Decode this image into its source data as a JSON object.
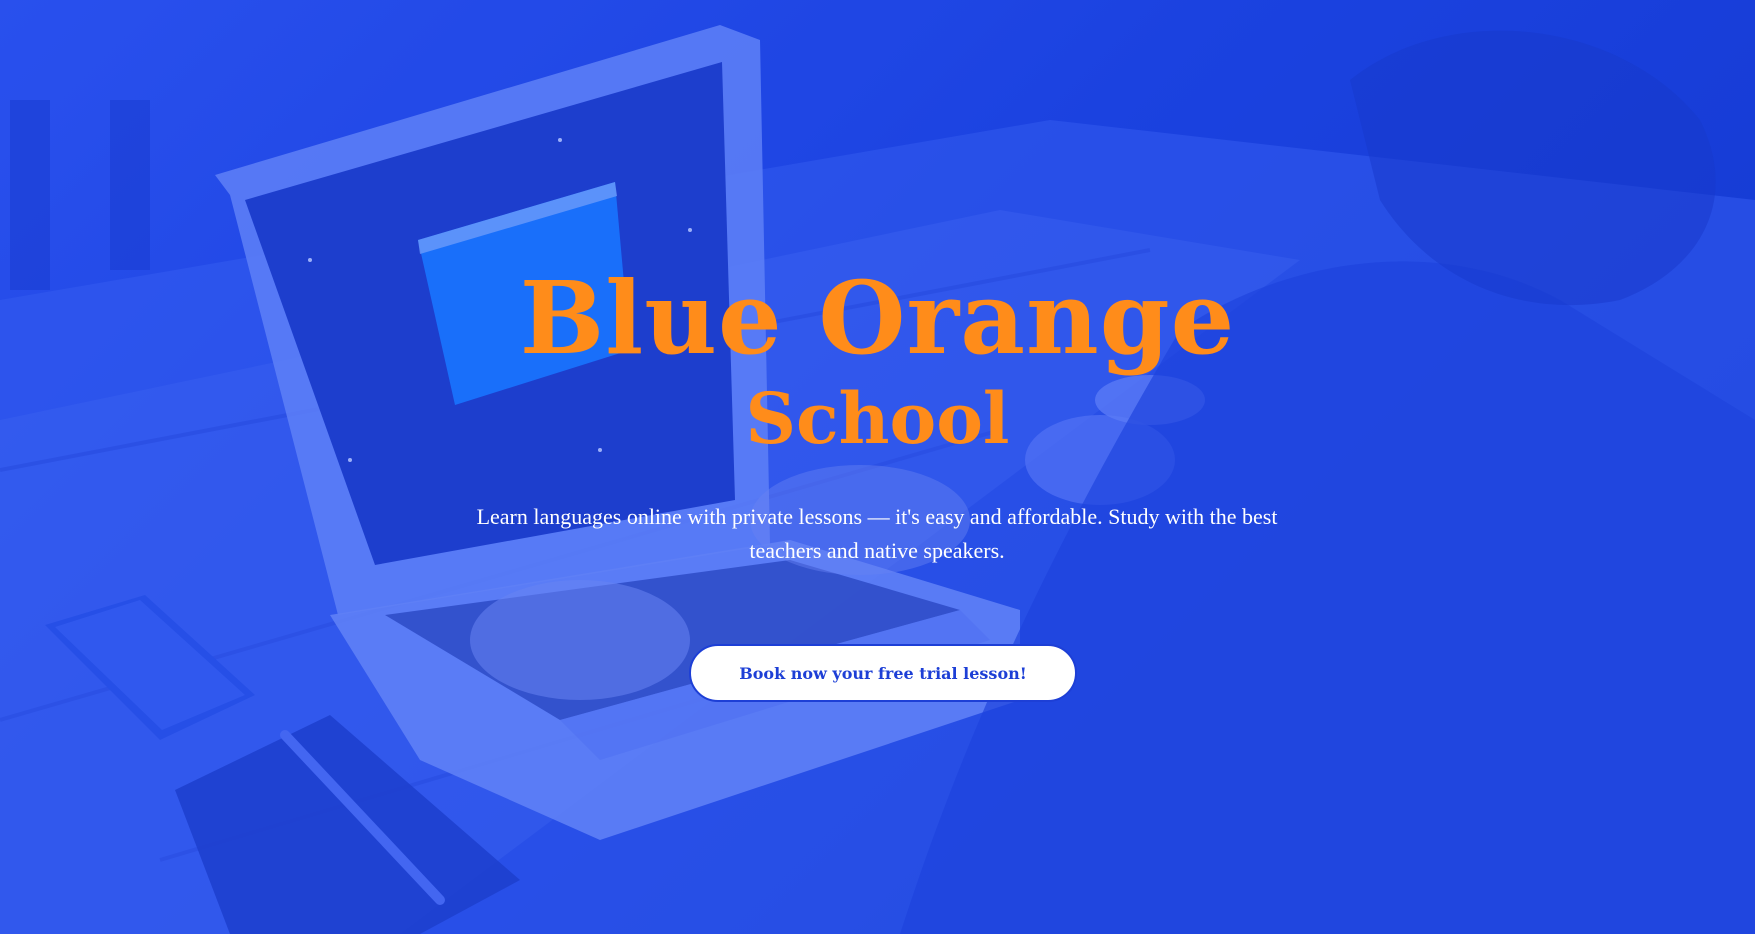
{
  "hero": {
    "title": "Blue Orange",
    "subtitle": "School",
    "tagline": "Learn languages online with private lessons — it's easy and affordable. Study with the best teachers and native speakers.",
    "cta_label": "Book now your free trial lesson!"
  },
  "colors": {
    "brand_orange": "#ff8c1a",
    "brand_blue": "#1d3fd6",
    "text_white": "#ffffff"
  },
  "background": {
    "icons": [
      "laptop-icon",
      "phone-icon",
      "notebook-icon",
      "pen-icon",
      "coffee-cup-icon"
    ]
  }
}
